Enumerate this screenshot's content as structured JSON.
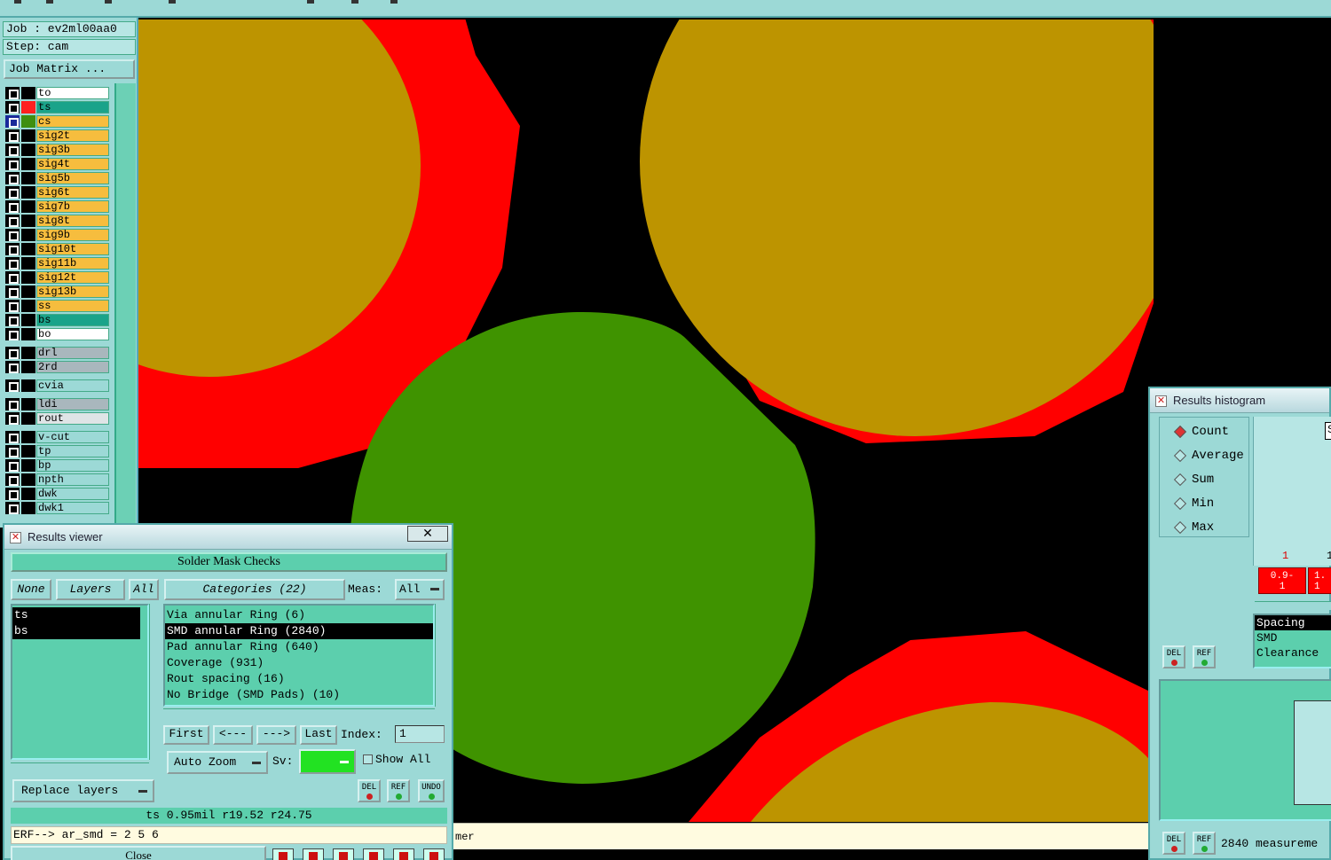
{
  "left_panel": {
    "job": "Job : ev2ml00aa0",
    "step": "Step: cam",
    "job_matrix": "Job Matrix ...",
    "layers": [
      {
        "name": "to",
        "swatch": "#000000",
        "bg": "#ffffff",
        "selected": false
      },
      {
        "name": "ts",
        "swatch": "#ff2020",
        "bg": "#1aa38a",
        "selected": false
      },
      {
        "name": "cs",
        "swatch": "#3f8f10",
        "bg": "#f6bd3e",
        "selected": true
      },
      {
        "name": "sig2t",
        "swatch": "#000000",
        "bg": "#f6bd3e",
        "selected": false
      },
      {
        "name": "sig3b",
        "swatch": "#000000",
        "bg": "#f6bd3e",
        "selected": false
      },
      {
        "name": "sig4t",
        "swatch": "#000000",
        "bg": "#f6bd3e",
        "selected": false
      },
      {
        "name": "sig5b",
        "swatch": "#000000",
        "bg": "#f6bd3e",
        "selected": false
      },
      {
        "name": "sig6t",
        "swatch": "#000000",
        "bg": "#f6bd3e",
        "selected": false
      },
      {
        "name": "sig7b",
        "swatch": "#000000",
        "bg": "#f6bd3e",
        "selected": false
      },
      {
        "name": "sig8t",
        "swatch": "#000000",
        "bg": "#f6bd3e",
        "selected": false
      },
      {
        "name": "sig9b",
        "swatch": "#000000",
        "bg": "#f6bd3e",
        "selected": false
      },
      {
        "name": "sig10t",
        "swatch": "#000000",
        "bg": "#f6bd3e",
        "selected": false
      },
      {
        "name": "sig11b",
        "swatch": "#000000",
        "bg": "#f6bd3e",
        "selected": false
      },
      {
        "name": "sig12t",
        "swatch": "#000000",
        "bg": "#f6bd3e",
        "selected": false
      },
      {
        "name": "sig13b",
        "swatch": "#000000",
        "bg": "#f6bd3e",
        "selected": false
      },
      {
        "name": "ss",
        "swatch": "#000000",
        "bg": "#f6bd3e",
        "selected": false
      },
      {
        "name": "bs",
        "swatch": "#000000",
        "bg": "#1aa38a",
        "selected": false
      },
      {
        "name": "bo",
        "swatch": "#000000",
        "bg": "#ffffff",
        "selected": false
      },
      {
        "name": "drl",
        "swatch": "#000000",
        "bg": "#a9b7bd",
        "selected": false
      },
      {
        "name": "2rd",
        "swatch": "#000000",
        "bg": "#a9b7bd",
        "selected": false
      },
      {
        "name": "cvia",
        "swatch": "#000000",
        "bg": "#9cd9d6",
        "selected": false
      },
      {
        "name": "ldi",
        "swatch": "#000000",
        "bg": "#a9b7bd",
        "selected": false
      },
      {
        "name": "rout",
        "swatch": "#000000",
        "bg": "#dfe4e6",
        "selected": false
      },
      {
        "name": "v-cut",
        "swatch": "#000000",
        "bg": "#9cd9d6",
        "selected": false
      },
      {
        "name": "tp",
        "swatch": "#000000",
        "bg": "#9cd9d6",
        "selected": false
      },
      {
        "name": "bp",
        "swatch": "#000000",
        "bg": "#9cd9d6",
        "selected": false
      },
      {
        "name": "npth",
        "swatch": "#000000",
        "bg": "#9cd9d6",
        "selected": false
      },
      {
        "name": "dwk",
        "swatch": "#000000",
        "bg": "#9cd9d6",
        "selected": false
      },
      {
        "name": "dwk1",
        "swatch": "#000000",
        "bg": "#9cd9d6",
        "selected": false
      }
    ]
  },
  "results_viewer": {
    "title": "Results viewer",
    "close_x": "✕",
    "header": "Solder Mask Checks",
    "none_label": "None",
    "layers_label": "Layers",
    "all_label": "All",
    "categories_label": "Categories (22)",
    "meas_label": "Meas:",
    "meas_value": "All",
    "layer_items": [
      "ts",
      "bs"
    ],
    "categories": [
      "Via annular Ring (6)",
      "SMD annular Ring (2840)",
      "Pad annular Ring (640)",
      "Coverage (931)",
      "Rout spacing (16)",
      "No Bridge (SMD Pads) (10)"
    ],
    "selected_category": 1,
    "first": "First",
    "prev": "<---",
    "next": "--->",
    "last": "Last",
    "index_label": "Index:",
    "index_value": "1",
    "auto_zoom": "Auto Zoom",
    "sv_label": "Sv:",
    "show_all": "Show All",
    "replace_layers": "Replace layers",
    "del": "DEL",
    "ref": "REF",
    "undo": "UNDO",
    "status": "ts 0.95mil  r19.52  r24.75",
    "erf": "ERF--> ar_smd = 2 5 6",
    "close": "Close",
    "sv_color": "#22e222"
  },
  "message_bar": {
    "text": "mer"
  },
  "histogram": {
    "title": "Results histogram",
    "modes": [
      "Count",
      "Average",
      "Sum",
      "Min",
      "Max"
    ],
    "selected_mode": 0,
    "bin_labels": [
      "1",
      "1"
    ],
    "bins": [
      "0.9-\n1",
      "1.\n1"
    ],
    "list": [
      "Spacing",
      "SMD",
      "Clearance"
    ],
    "selected_list": 0,
    "measurements": "2840 measureme",
    "del": "DEL",
    "ref": "REF",
    "corner_letter": "S"
  },
  "colors": {
    "background": "#9cd9d6",
    "pad_gold": "#bd9400",
    "mask_red": "#ff0000",
    "copper_green": "#3f9300"
  }
}
